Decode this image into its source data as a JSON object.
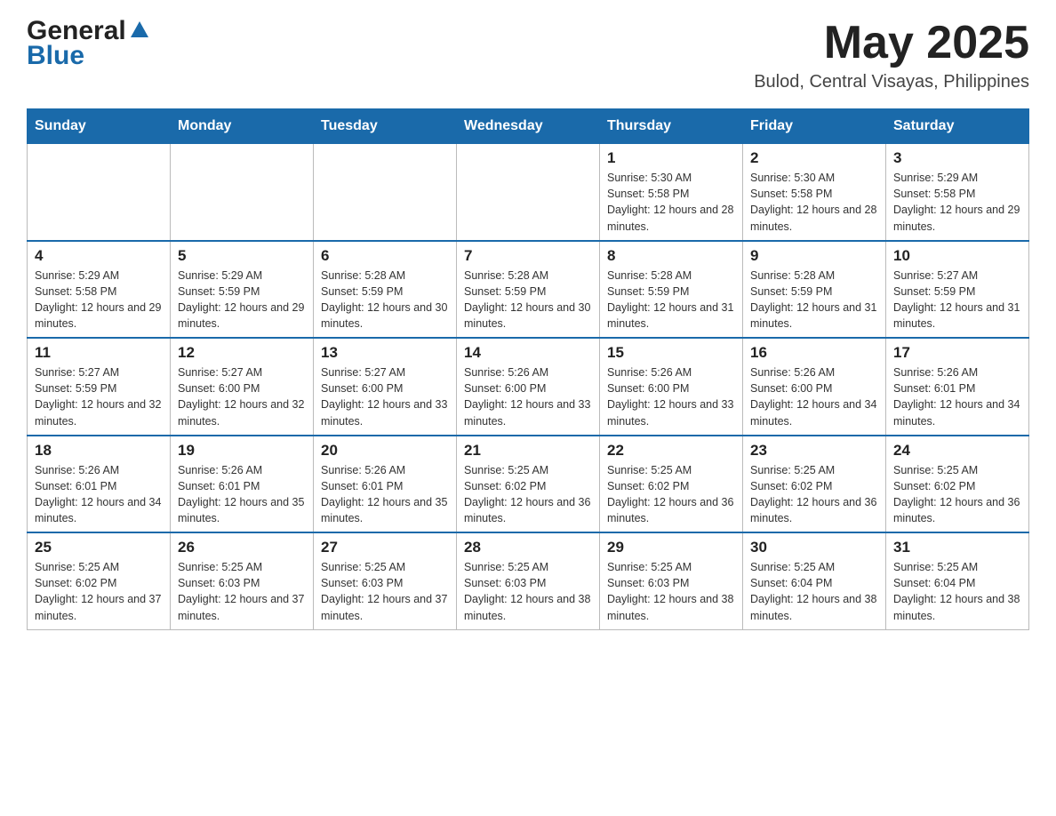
{
  "header": {
    "logo_general": "General",
    "logo_blue": "Blue",
    "month_title": "May 2025",
    "location": "Bulod, Central Visayas, Philippines"
  },
  "calendar": {
    "days_of_week": [
      "Sunday",
      "Monday",
      "Tuesday",
      "Wednesday",
      "Thursday",
      "Friday",
      "Saturday"
    ],
    "weeks": [
      [
        {
          "day": "",
          "info": ""
        },
        {
          "day": "",
          "info": ""
        },
        {
          "day": "",
          "info": ""
        },
        {
          "day": "",
          "info": ""
        },
        {
          "day": "1",
          "info": "Sunrise: 5:30 AM\nSunset: 5:58 PM\nDaylight: 12 hours and 28 minutes."
        },
        {
          "day": "2",
          "info": "Sunrise: 5:30 AM\nSunset: 5:58 PM\nDaylight: 12 hours and 28 minutes."
        },
        {
          "day": "3",
          "info": "Sunrise: 5:29 AM\nSunset: 5:58 PM\nDaylight: 12 hours and 29 minutes."
        }
      ],
      [
        {
          "day": "4",
          "info": "Sunrise: 5:29 AM\nSunset: 5:58 PM\nDaylight: 12 hours and 29 minutes."
        },
        {
          "day": "5",
          "info": "Sunrise: 5:29 AM\nSunset: 5:59 PM\nDaylight: 12 hours and 29 minutes."
        },
        {
          "day": "6",
          "info": "Sunrise: 5:28 AM\nSunset: 5:59 PM\nDaylight: 12 hours and 30 minutes."
        },
        {
          "day": "7",
          "info": "Sunrise: 5:28 AM\nSunset: 5:59 PM\nDaylight: 12 hours and 30 minutes."
        },
        {
          "day": "8",
          "info": "Sunrise: 5:28 AM\nSunset: 5:59 PM\nDaylight: 12 hours and 31 minutes."
        },
        {
          "day": "9",
          "info": "Sunrise: 5:28 AM\nSunset: 5:59 PM\nDaylight: 12 hours and 31 minutes."
        },
        {
          "day": "10",
          "info": "Sunrise: 5:27 AM\nSunset: 5:59 PM\nDaylight: 12 hours and 31 minutes."
        }
      ],
      [
        {
          "day": "11",
          "info": "Sunrise: 5:27 AM\nSunset: 5:59 PM\nDaylight: 12 hours and 32 minutes."
        },
        {
          "day": "12",
          "info": "Sunrise: 5:27 AM\nSunset: 6:00 PM\nDaylight: 12 hours and 32 minutes."
        },
        {
          "day": "13",
          "info": "Sunrise: 5:27 AM\nSunset: 6:00 PM\nDaylight: 12 hours and 33 minutes."
        },
        {
          "day": "14",
          "info": "Sunrise: 5:26 AM\nSunset: 6:00 PM\nDaylight: 12 hours and 33 minutes."
        },
        {
          "day": "15",
          "info": "Sunrise: 5:26 AM\nSunset: 6:00 PM\nDaylight: 12 hours and 33 minutes."
        },
        {
          "day": "16",
          "info": "Sunrise: 5:26 AM\nSunset: 6:00 PM\nDaylight: 12 hours and 34 minutes."
        },
        {
          "day": "17",
          "info": "Sunrise: 5:26 AM\nSunset: 6:01 PM\nDaylight: 12 hours and 34 minutes."
        }
      ],
      [
        {
          "day": "18",
          "info": "Sunrise: 5:26 AM\nSunset: 6:01 PM\nDaylight: 12 hours and 34 minutes."
        },
        {
          "day": "19",
          "info": "Sunrise: 5:26 AM\nSunset: 6:01 PM\nDaylight: 12 hours and 35 minutes."
        },
        {
          "day": "20",
          "info": "Sunrise: 5:26 AM\nSunset: 6:01 PM\nDaylight: 12 hours and 35 minutes."
        },
        {
          "day": "21",
          "info": "Sunrise: 5:25 AM\nSunset: 6:02 PM\nDaylight: 12 hours and 36 minutes."
        },
        {
          "day": "22",
          "info": "Sunrise: 5:25 AM\nSunset: 6:02 PM\nDaylight: 12 hours and 36 minutes."
        },
        {
          "day": "23",
          "info": "Sunrise: 5:25 AM\nSunset: 6:02 PM\nDaylight: 12 hours and 36 minutes."
        },
        {
          "day": "24",
          "info": "Sunrise: 5:25 AM\nSunset: 6:02 PM\nDaylight: 12 hours and 36 minutes."
        }
      ],
      [
        {
          "day": "25",
          "info": "Sunrise: 5:25 AM\nSunset: 6:02 PM\nDaylight: 12 hours and 37 minutes."
        },
        {
          "day": "26",
          "info": "Sunrise: 5:25 AM\nSunset: 6:03 PM\nDaylight: 12 hours and 37 minutes."
        },
        {
          "day": "27",
          "info": "Sunrise: 5:25 AM\nSunset: 6:03 PM\nDaylight: 12 hours and 37 minutes."
        },
        {
          "day": "28",
          "info": "Sunrise: 5:25 AM\nSunset: 6:03 PM\nDaylight: 12 hours and 38 minutes."
        },
        {
          "day": "29",
          "info": "Sunrise: 5:25 AM\nSunset: 6:03 PM\nDaylight: 12 hours and 38 minutes."
        },
        {
          "day": "30",
          "info": "Sunrise: 5:25 AM\nSunset: 6:04 PM\nDaylight: 12 hours and 38 minutes."
        },
        {
          "day": "31",
          "info": "Sunrise: 5:25 AM\nSunset: 6:04 PM\nDaylight: 12 hours and 38 minutes."
        }
      ]
    ]
  }
}
